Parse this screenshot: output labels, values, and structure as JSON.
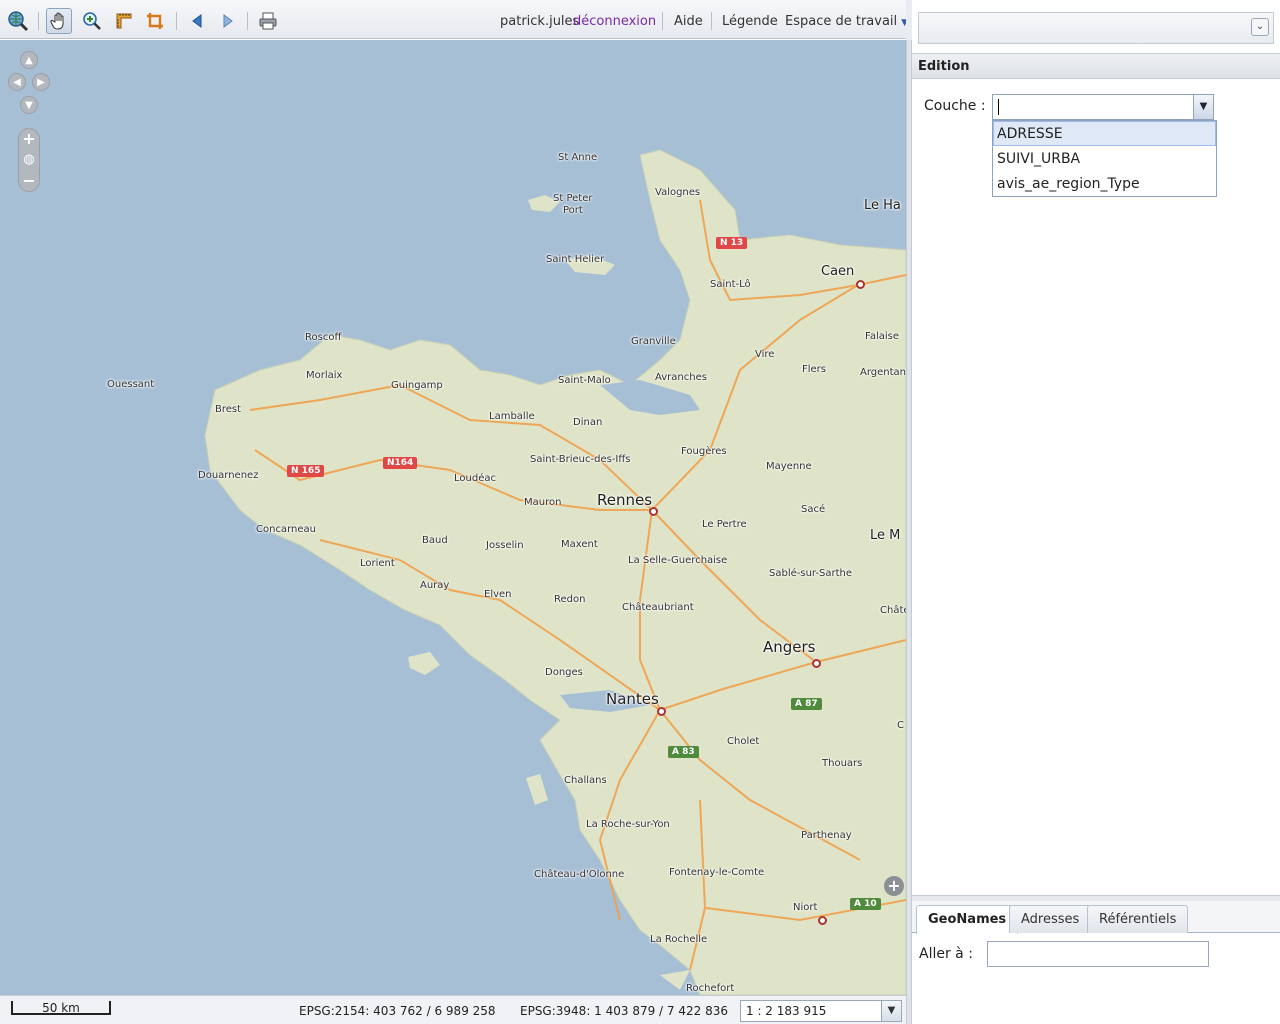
{
  "toolbar": {
    "user": "patrick.jules",
    "logout": "déconnexion",
    "help": "Aide",
    "legend": "Légende",
    "workspace": "Espace de travail"
  },
  "map": {
    "places": {
      "st_anne": "St Anne",
      "st_peter_port_1": "St Peter",
      "st_peter_port_2": "Port",
      "saint_helier": "Saint Helier",
      "valognes": "Valognes",
      "le_havre": "Le Ha",
      "caen": "Caen",
      "saint_lo": "Saint-Lô",
      "falaise": "Falaise",
      "argentan": "Argentan",
      "granville": "Granville",
      "vire": "Vire",
      "flers": "Flers",
      "roscoff": "Roscoff",
      "morlaix": "Morlaix",
      "guingamp": "Guingamp",
      "ouessant": "Ouessant",
      "brest": "Brest",
      "saint_malo": "Saint-Malo",
      "avranches": "Avranches",
      "lamballe": "Lamballe",
      "dinan": "Dinan",
      "douarnenez": "Douarnenez",
      "saint_brieuc": "Saint-Brieuc-des-Iffs",
      "fougeres": "Fougères",
      "loudeac": "Loudéac",
      "mayenne": "Mayenne",
      "rennes": "Rennes",
      "mauron": "Mauron",
      "sace": "Sacé",
      "le_mans": "Le M",
      "concarneau": "Concarneau",
      "le_pertre": "Le Pertre",
      "baud": "Baud",
      "josselin": "Josselin",
      "maxent": "Maxent",
      "lorient": "Lorient",
      "la_selle": "La Selle-Guerchaise",
      "sable": "Sablé-sur-Sarthe",
      "auray": "Auray",
      "elven": "Elven",
      "redon": "Redon",
      "chateaubriant": "Châteaubriant",
      "chateau_right": "Châte",
      "angers": "Angers",
      "donges": "Donges",
      "nantes": "Nantes",
      "cholet": "Cholet",
      "challans": "Challans",
      "thouars": "Thouars",
      "la_roche": "La Roche-sur-Yon",
      "parthenay": "Parthenay",
      "chateau_olonne": "Château-d'Olonne",
      "fontenay": "Fontenay-le-Comte",
      "niort": "Niort",
      "la_rochelle": "La Rochelle",
      "rochefort": "Rochefort",
      "c_right": "C"
    },
    "shields": {
      "n13": "N 13",
      "n165": "N 165",
      "n164": "N164",
      "a87": "A 87",
      "a83": "A 83",
      "a10": "A 10"
    },
    "colors": {
      "sea": "#a7bfd5",
      "land": "#dfe4c8",
      "roads": "#f0a04b"
    }
  },
  "status": {
    "scale_label": "50 km",
    "coord_2154": "EPSG:2154: 403 762 / 6 989 258",
    "coord_3948": "EPSG:3948: 1 403 879 / 7 422 836",
    "scale_value": "1 : 2 183 915"
  },
  "panel": {
    "section_title": "Edition",
    "layer_label": "Couche :",
    "layer_options": [
      "ADRESSE",
      "SUIVI_URBA",
      "avis_ae_region_Type"
    ],
    "tabs": [
      "GeoNames",
      "Adresses",
      "Référentiels"
    ],
    "goto_label": "Aller à :"
  }
}
